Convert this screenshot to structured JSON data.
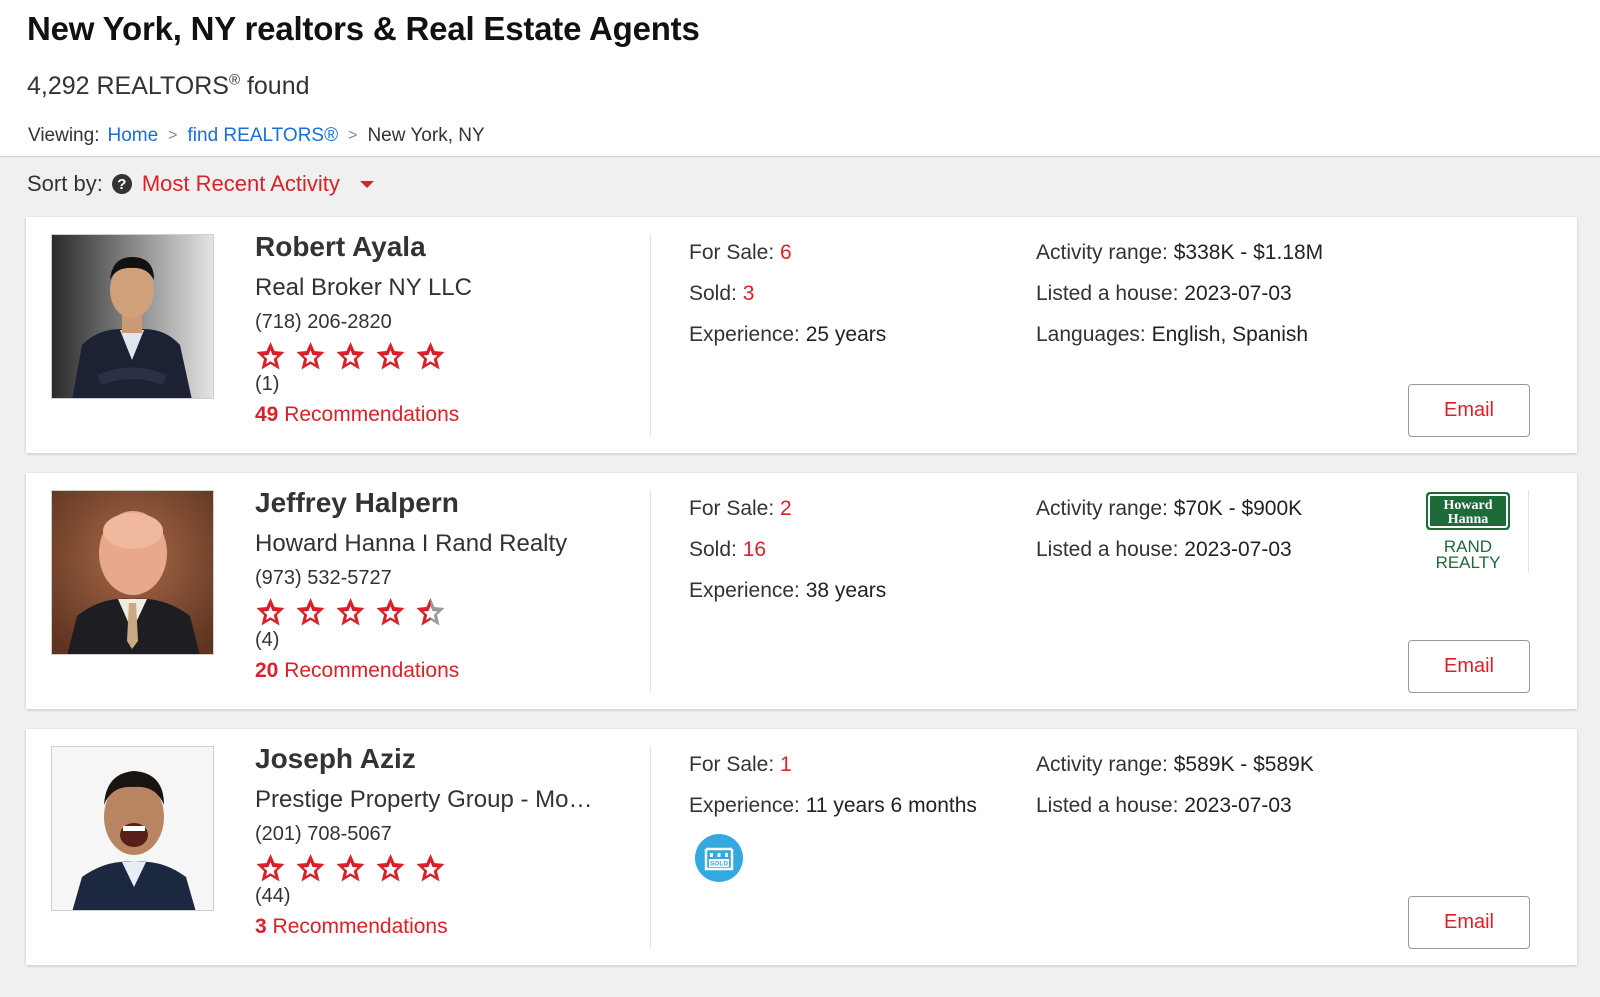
{
  "header": {
    "title": "New York, NY realtors & Real Estate Agents",
    "found_count": "4,292 REALTORS",
    "found_mark": "®",
    "found_suffix": " found"
  },
  "breadcrumb": {
    "label": "Viewing:",
    "items": [
      "Home",
      "find REALTORS®",
      "New York, NY"
    ],
    "separator": ">"
  },
  "sort": {
    "label": "Sort by:",
    "help_icon": "?",
    "value": "Most Recent Activity"
  },
  "colors": {
    "accent": "#d92228",
    "link": "#1a6ed8",
    "brand_green": "#1e6b3a",
    "sold_badge": "#33a9df"
  },
  "agents": [
    {
      "name": "Robert Ayala",
      "office": "Real Broker NY LLC",
      "phone": "(718) 206-2820",
      "rating": 5,
      "reviews": "(1)",
      "recommend_count": "49",
      "recommend_label": " Recommendations",
      "stats_left": [
        {
          "label": "For Sale: ",
          "value": "6",
          "red": true
        },
        {
          "label": "Sold: ",
          "value": "3",
          "red": true
        },
        {
          "label": "Experience: ",
          "value": "25 years",
          "red": false
        }
      ],
      "stats_right": [
        {
          "label": "Activity range: ",
          "value": "$338K - $1.18M"
        },
        {
          "label": "Listed a house: ",
          "value": "2023-07-03"
        },
        {
          "label": "Languages: ",
          "value": "English, Spanish"
        }
      ],
      "email_label": "Email"
    },
    {
      "name": "Jeffrey Halpern",
      "office": "Howard Hanna I Rand Realty",
      "phone": "(973) 532-5727",
      "rating": 4.5,
      "reviews": "(4)",
      "recommend_count": "20",
      "recommend_label": " Recommendations",
      "stats_left": [
        {
          "label": "For Sale: ",
          "value": "2",
          "red": true
        },
        {
          "label": "Sold: ",
          "value": "16",
          "red": true
        },
        {
          "label": "Experience: ",
          "value": "38 years",
          "red": false
        }
      ],
      "stats_right": [
        {
          "label": "Activity range: ",
          "value": "$70K - $900K"
        },
        {
          "label": "Listed a house: ",
          "value": "2023-07-03"
        }
      ],
      "brand_logo": {
        "line1": "Howard",
        "line2": "Hanna",
        "line3": "RAND",
        "line4": "REALTY"
      },
      "email_label": "Email"
    },
    {
      "name": "Joseph Aziz",
      "office": "Prestige Property Group - Mo…",
      "phone": "(201) 708-5067",
      "rating": 5,
      "reviews": "(44)",
      "recommend_count": "3",
      "recommend_label": " Recommendations",
      "stats_left": [
        {
          "label": "For Sale: ",
          "value": "1",
          "red": true
        },
        {
          "label": "Experience: ",
          "value": "11 years 6 months",
          "red": false
        }
      ],
      "stats_right": [
        {
          "label": "Activity range: ",
          "value": "$589K - $589K"
        },
        {
          "label": "Listed a house: ",
          "value": "2023-07-03"
        }
      ],
      "badge": {
        "icon": "sold-badge-icon",
        "text": "SOLD"
      },
      "email_label": "Email"
    }
  ]
}
